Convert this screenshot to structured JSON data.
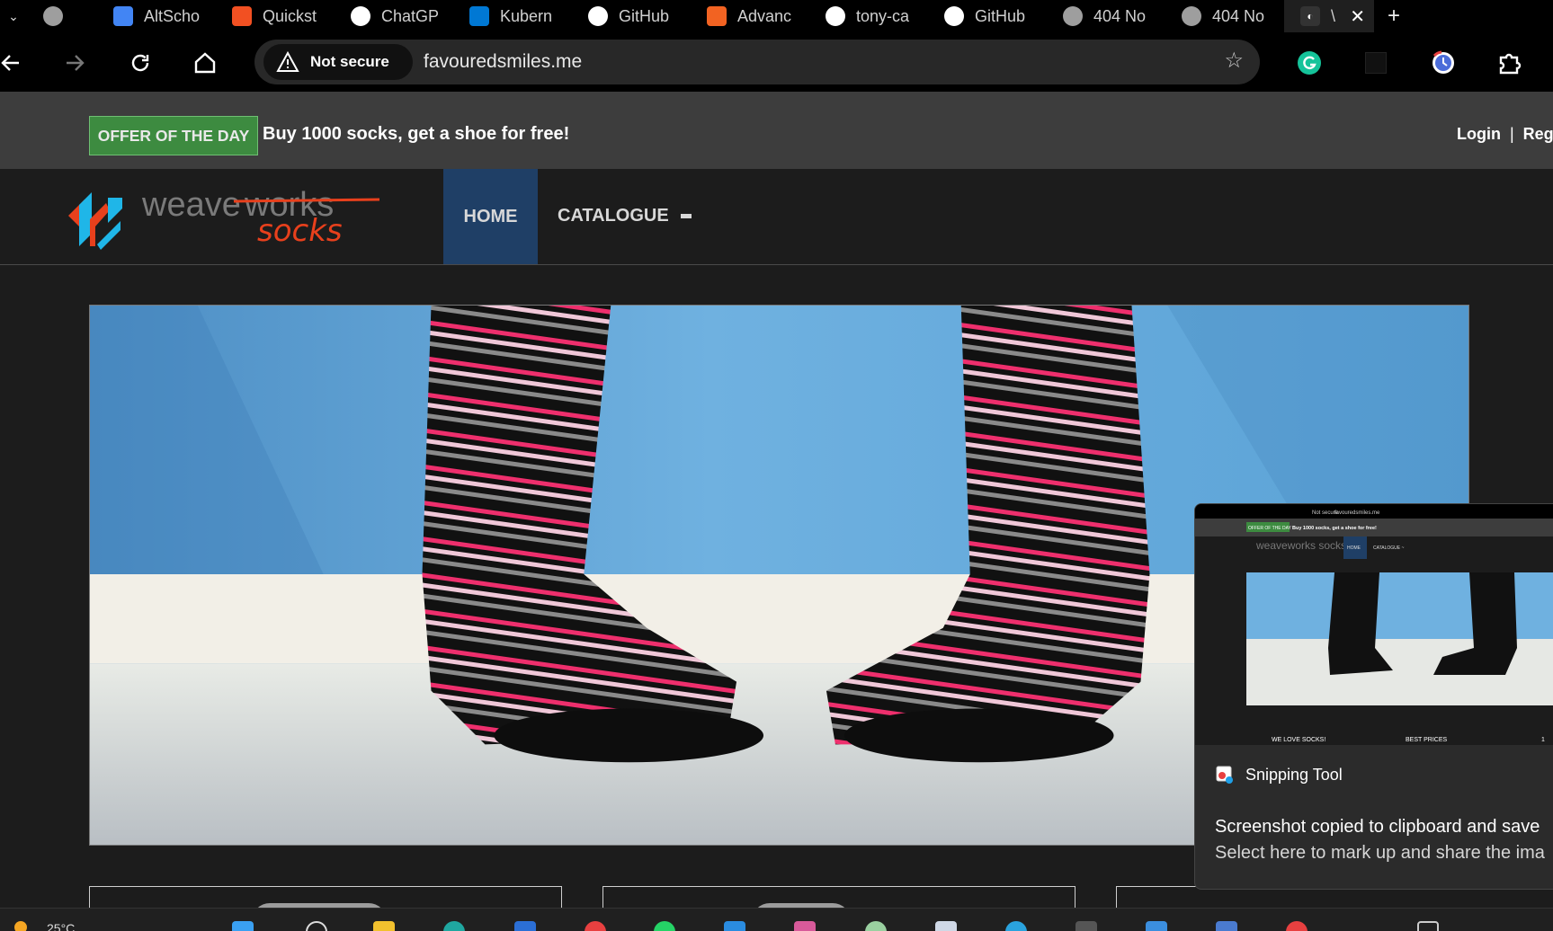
{
  "browser": {
    "tabs": [
      {
        "title": "",
        "icon": "globe-icon",
        "color": "#9e9e9e"
      },
      {
        "title": "AltScho",
        "icon": "docs-icon",
        "color": "#4285f4"
      },
      {
        "title": "Quickst",
        "icon": "microsoft-icon",
        "color": "#f25022"
      },
      {
        "title": "ChatGP",
        "icon": "openai-icon",
        "color": "#ffffff"
      },
      {
        "title": "Kubern",
        "icon": "azure-icon",
        "color": "#0078d4"
      },
      {
        "title": "GitHub",
        "icon": "github-icon",
        "color": "#ffffff"
      },
      {
        "title": "Advanc",
        "icon": "tab-orange-icon",
        "color": "#f26322"
      },
      {
        "title": "tony-ca",
        "icon": "github-icon",
        "color": "#ffffff"
      },
      {
        "title": "GitHub",
        "icon": "github-icon",
        "color": "#ffffff"
      },
      {
        "title": "404 No",
        "icon": "globe-icon",
        "color": "#9e9e9e"
      },
      {
        "title": "404 No",
        "icon": "globe-icon",
        "color": "#9e9e9e"
      }
    ],
    "active_tab": {
      "title": "\\",
      "close": "✕"
    },
    "new_tab": "+",
    "security_label": "Not secure",
    "url": "favouredsmiles.me"
  },
  "site": {
    "offer_badge": "OFFER OF THE DAY",
    "offer_text": "Buy 1000 socks, get a shoe for free!",
    "login": "Login",
    "separator": "|",
    "register": "Reg",
    "logo_word1": "weave",
    "logo_word2": "works",
    "logo_word3": "socks",
    "nav": {
      "home": "HOME",
      "catalogue": "CATALOGUE"
    },
    "colors": {
      "offer_green": "#3d8b40",
      "nav_active": "#1f3f66",
      "logo_red": "#e8401c",
      "logo_blue": "#1fb6e8"
    }
  },
  "notification": {
    "app": "Snipping Tool",
    "line1": "Screenshot copied to clipboard and save",
    "line2": "Select here to mark up and share the ima",
    "thumb": {
      "not_secure": "Not secure",
      "url": "favouredsmiles.me",
      "offer_badge": "OFFER OF THE DAY",
      "offer_text": "Buy 1000 socks, get a shoe for free!",
      "logo": "weaveworks socks",
      "home": "HOME",
      "catalogue": "CATALOGUE ~",
      "card1": "WE LOVE SOCKS!",
      "card2": "BEST PRICES",
      "card3": "1"
    }
  },
  "taskbar": {
    "weather": "25°C"
  }
}
